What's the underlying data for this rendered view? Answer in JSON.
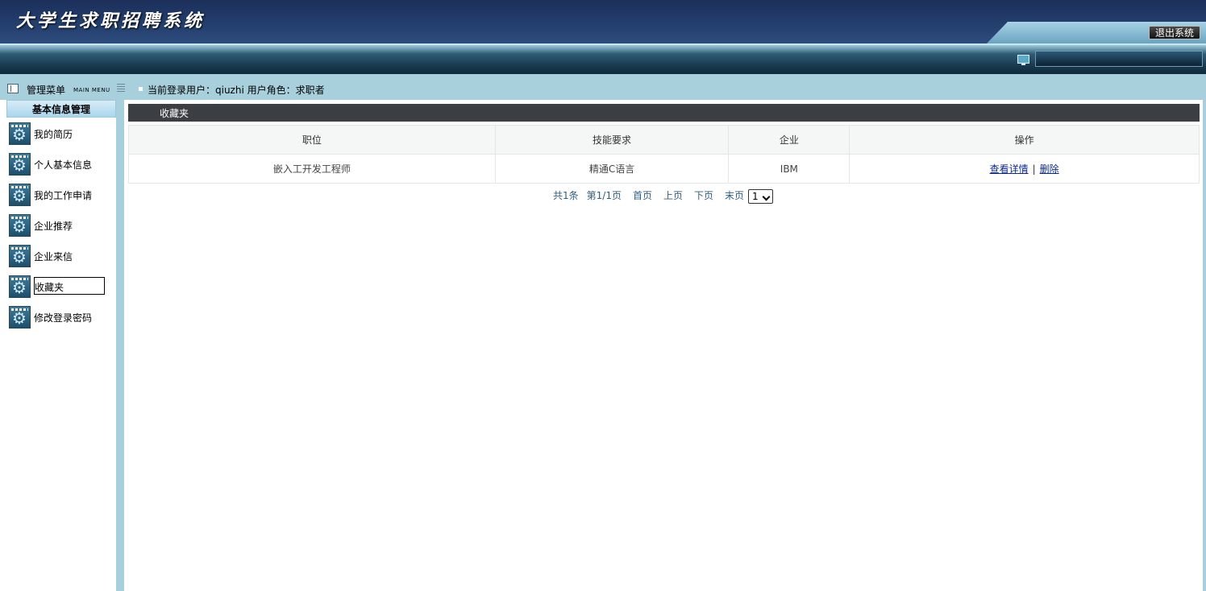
{
  "header": {
    "app_title": "大学生求职招聘系统",
    "logout_label": "退出系统"
  },
  "menu_header": {
    "title": "管理菜单",
    "subtitle": "MAIN MENU"
  },
  "userbar": {
    "text": "当前登录用户：qiuzhi  用户角色：求职者"
  },
  "sidebar": {
    "group_title": "基本信息管理",
    "items": [
      {
        "label": "我的简历",
        "icon": "gear-window-icon"
      },
      {
        "label": "个人基本信息",
        "icon": "gear-window-icon"
      },
      {
        "label": "我的工作申请",
        "icon": "gear-window-icon"
      },
      {
        "label": "企业推荐",
        "icon": "gear-window-icon"
      },
      {
        "label": "企业来信",
        "icon": "gear-window-icon"
      },
      {
        "label": "收藏夹",
        "icon": "gear-window-icon",
        "active": true
      },
      {
        "label": "修改登录密码",
        "icon": "gear-window-icon"
      }
    ]
  },
  "content": {
    "title": "收藏夹",
    "table": {
      "headers": [
        "职位",
        "技能要求",
        "企业",
        "操作"
      ],
      "rows": [
        {
          "position": "嵌入工开发工程师",
          "skills": "精通C语言",
          "company": "IBM",
          "view_label": "查看详情",
          "delete_label": "删除"
        }
      ]
    },
    "pager": {
      "total": "共1条",
      "page_info": "第1/1页",
      "first": "首页",
      "prev": "上页",
      "next": "下页",
      "last": "末页",
      "selected_page": "1"
    }
  },
  "colors": {
    "header_bg": "#24406f",
    "frame_bg": "#a7cfdc",
    "title_bar_bg": "#3b3e43",
    "link": "#0d2a8f"
  }
}
